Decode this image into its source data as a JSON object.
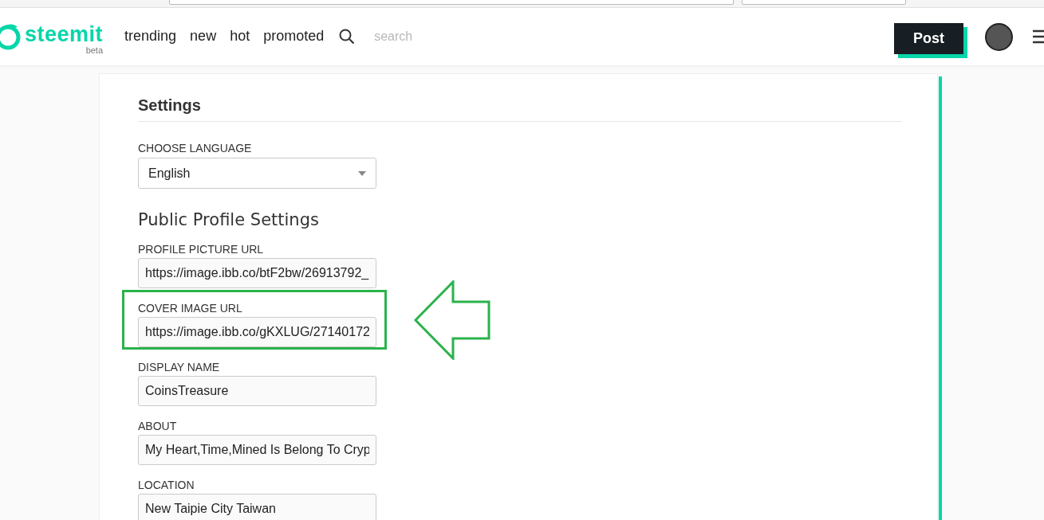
{
  "header": {
    "logo": {
      "name": "steemit",
      "tag": "beta"
    },
    "nav": [
      {
        "label": "trending"
      },
      {
        "label": "new"
      },
      {
        "label": "hot"
      },
      {
        "label": "promoted"
      }
    ],
    "search": {
      "placeholder": "search"
    },
    "post_button": "Post"
  },
  "settings": {
    "title": "Settings",
    "language": {
      "label": "CHOOSE LANGUAGE",
      "value": "English"
    },
    "profile_heading": "Public Profile Settings",
    "fields": [
      {
        "label": "PROFILE PICTURE URL",
        "value": "https://image.ibb.co/btF2bw/26913792_",
        "highlighted": false
      },
      {
        "label": "COVER IMAGE URL",
        "value": "https://image.ibb.co/gKXLUG/27140172",
        "highlighted": true
      },
      {
        "label": "DISPLAY NAME",
        "value": "CoinsTreasure",
        "highlighted": false
      },
      {
        "label": "ABOUT",
        "value": "My Heart,Time,Mined Is Belong To Cryp",
        "highlighted": false
      },
      {
        "label": "LOCATION",
        "value": "New Taipie City Taiwan",
        "highlighted": false
      }
    ]
  }
}
